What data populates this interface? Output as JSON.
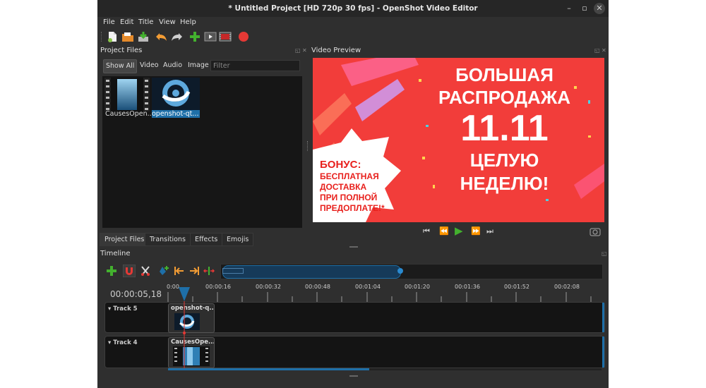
{
  "window": {
    "title": "* Untitled Project [HD 720p 30 fps] - OpenShot Video Editor",
    "controls": [
      "–",
      "▫",
      "✕"
    ]
  },
  "menu": [
    "File",
    "Edit",
    "Title",
    "View",
    "Help"
  ],
  "toolbar": {
    "icons": [
      "new-project-icon",
      "open-project-icon",
      "save-project-icon",
      "undo-icon",
      "redo-icon",
      "import-files-icon",
      "preview-icon",
      "export-film-icon",
      "record-icon"
    ]
  },
  "project_files": {
    "title": "Project Files",
    "filters": [
      "Show All",
      "Video",
      "Audio",
      "Image"
    ],
    "filter_placeholder": "Filter",
    "files": [
      {
        "name": "CausesOpen...",
        "selected": false
      },
      {
        "name": "openshot-qt...",
        "selected": true
      }
    ]
  },
  "bottom_tabs": [
    "Project Files",
    "Transitions",
    "Effects",
    "Emojis"
  ],
  "video_preview": {
    "title": "Video Preview",
    "frame": {
      "line1": "БОЛЬШАЯ",
      "line2": "РАСПРОДАЖА",
      "line3": "11.11",
      "line4": "ЦЕЛУЮ",
      "line5": "НЕДЕЛЮ!",
      "bonus1": "БОНУС:",
      "bonus2": "БЕСПЛАТНАЯ",
      "bonus3": "ДОСТАВКА",
      "bonus4": "ПРИ ПОЛНОЙ",
      "bonus5": "ПРЕДОПЛАТЕ!*"
    },
    "controls": [
      "⏮",
      "⏪",
      "▶",
      "⏩",
      "⏭"
    ]
  },
  "timeline": {
    "title": "Timeline",
    "current_time": "00:00:05,18",
    "ruler": [
      "0:00",
      "00:00:16",
      "00:00:32",
      "00:00:48",
      "00:01:04",
      "00:01:20",
      "00:01:36",
      "00:01:52",
      "00:02:08"
    ],
    "tracks": [
      {
        "name": "Track 5",
        "clip": "openshot-q..."
      },
      {
        "name": "Track 4",
        "clip": "CausesOpe..."
      }
    ]
  },
  "colors": {
    "accent": "#1e6fa8",
    "preview_bg": "#f23d3a",
    "add": "#43b12e",
    "record": "#e53935"
  }
}
